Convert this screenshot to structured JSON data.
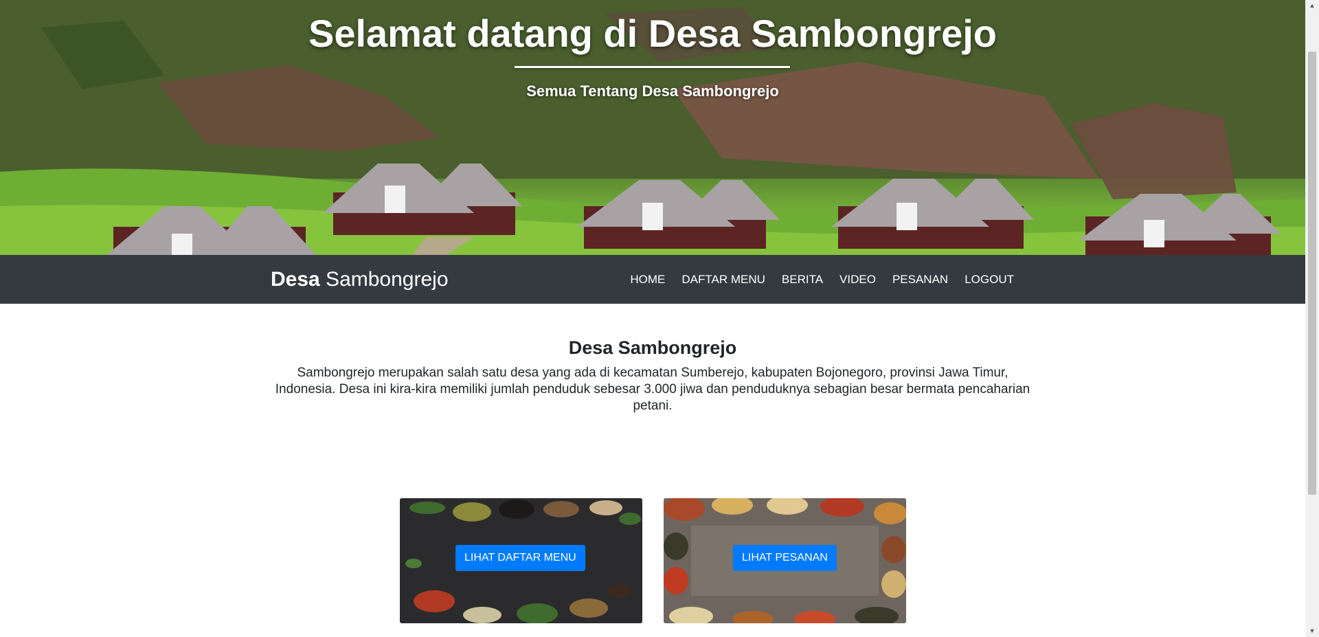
{
  "hero": {
    "title": "Selamat datang di Desa Sambongrejo",
    "subtitle": "Semua Tentang Desa Sambongrejo"
  },
  "navbar": {
    "brand_bold": "Desa",
    "brand_rest": " Sambongrejo",
    "items": [
      {
        "label": "HOME"
      },
      {
        "label": "DAFTAR MENU"
      },
      {
        "label": "BERITA"
      },
      {
        "label": "VIDEO"
      },
      {
        "label": "PESANAN"
      },
      {
        "label": "LOGOUT"
      }
    ],
    "background_color": "#343a40"
  },
  "intro": {
    "title": "Desa Sambongrejo",
    "text": "Sambongrejo merupakan salah satu desa yang ada di kecamatan Sumberejo, kabupaten Bojonegoro, provinsi Jawa Timur, Indonesia. Desa ini kira-kira memiliki jumlah penduduk sebesar 3.000 jiwa dan penduduknya sebagian besar bermata pencaharian petani."
  },
  "cards": [
    {
      "button_label": "LIHAT DAFTAR MENU",
      "image": "spices-on-dark-stone"
    },
    {
      "button_label": "LIHAT PESANAN",
      "image": "spice-bowls-frame-on-wood"
    }
  ],
  "colors": {
    "accent": "#007bff",
    "text": "#212529"
  },
  "icons": {
    "scroll_up": "scroll-up-arrow-icon",
    "scroll_down": "scroll-down-arrow-icon"
  }
}
